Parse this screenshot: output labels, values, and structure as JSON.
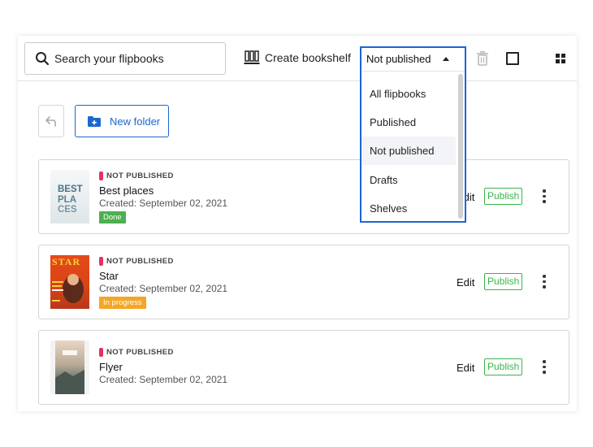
{
  "toolbar": {
    "search_placeholder": "Search your flipbooks",
    "create_bookshelf_label": "Create bookshelf",
    "filter_selected": "Not published"
  },
  "actions": {
    "new_folder_label": "New folder"
  },
  "filter_options": [
    "All flipbooks",
    "Published",
    "Not published",
    "Drafts",
    "Shelves"
  ],
  "flipbooks": [
    {
      "status": "NOT PUBLISHED",
      "title": "Best places",
      "created": "Created: September 02, 2021",
      "tag": "Done",
      "edit": "Edit",
      "publish": "Publish",
      "thumb_text": "BEST PLA CES"
    },
    {
      "status": "NOT PUBLISHED",
      "title": "Star",
      "created": "Created: September 02, 2021",
      "tag": "In progress",
      "edit": "Edit",
      "publish": "Publish",
      "thumb_text": "STAR"
    },
    {
      "status": "NOT PUBLISHED",
      "title": "Flyer",
      "created": "Created: September 02, 2021",
      "edit": "Edit",
      "publish": "Publish"
    }
  ],
  "colors": {
    "accent": "#1a67d2",
    "publish_green": "#3ab54a",
    "status_dot": "#e8315f",
    "done_tag": "#4caf50",
    "progress_tag": "#f5a623"
  }
}
